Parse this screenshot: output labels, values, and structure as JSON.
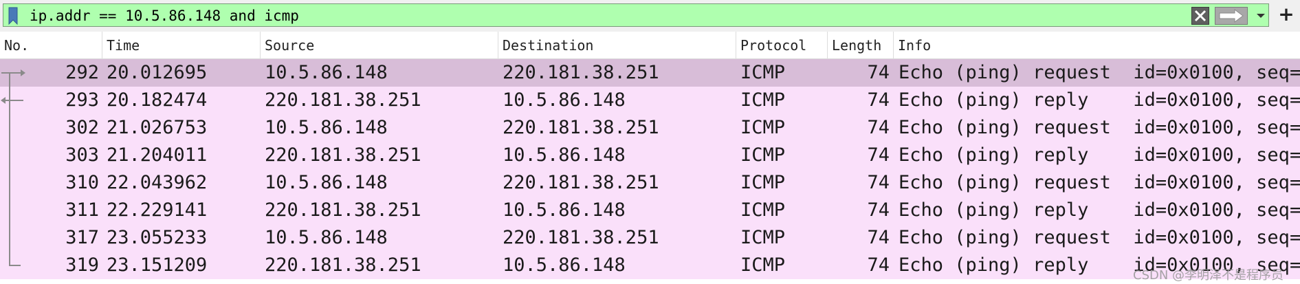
{
  "filter": {
    "value": "ip.addr == 10.5.86.148 and icmp",
    "bg_color": "#afffaf"
  },
  "toolbar": {
    "bookmark_icon": "bookmark-icon",
    "clear_icon": "clear-icon",
    "apply_icon": "arrow-right-icon",
    "dropdown_icon": "chevron-down-icon",
    "add_label": "+"
  },
  "columns": [
    "No.",
    "Time",
    "Source",
    "Destination",
    "Protocol",
    "Length",
    "Info"
  ],
  "rows": [
    {
      "no": "292",
      "time": "20.012695",
      "src": "10.5.86.148",
      "dst": "220.181.38.251",
      "proto": "ICMP",
      "len": "74",
      "info": "Echo (ping) request  id=0x0100, seq=",
      "selected": true
    },
    {
      "no": "293",
      "time": "20.182474",
      "src": "220.181.38.251",
      "dst": "10.5.86.148",
      "proto": "ICMP",
      "len": "74",
      "info": "Echo (ping) reply    id=0x0100, seq="
    },
    {
      "no": "302",
      "time": "21.026753",
      "src": "10.5.86.148",
      "dst": "220.181.38.251",
      "proto": "ICMP",
      "len": "74",
      "info": "Echo (ping) request  id=0x0100, seq="
    },
    {
      "no": "303",
      "time": "21.204011",
      "src": "220.181.38.251",
      "dst": "10.5.86.148",
      "proto": "ICMP",
      "len": "74",
      "info": "Echo (ping) reply    id=0x0100, seq="
    },
    {
      "no": "310",
      "time": "22.043962",
      "src": "10.5.86.148",
      "dst": "220.181.38.251",
      "proto": "ICMP",
      "len": "74",
      "info": "Echo (ping) request  id=0x0100, seq="
    },
    {
      "no": "311",
      "time": "22.229141",
      "src": "220.181.38.251",
      "dst": "10.5.86.148",
      "proto": "ICMP",
      "len": "74",
      "info": "Echo (ping) reply    id=0x0100, seq="
    },
    {
      "no": "317",
      "time": "23.055233",
      "src": "10.5.86.148",
      "dst": "220.181.38.251",
      "proto": "ICMP",
      "len": "74",
      "info": "Echo (ping) request  id=0x0100, seq="
    },
    {
      "no": "319",
      "time": "23.151209",
      "src": "220.181.38.251",
      "dst": "10.5.86.148",
      "proto": "ICMP",
      "len": "74",
      "info": "Echo (ping) reply    id=0x0100, seq="
    }
  ],
  "colors": {
    "row_bg": "#fae0fa",
    "row_selected_bg": "#d8bdd8"
  },
  "watermark": "CSDN @李明泽不是程序员"
}
